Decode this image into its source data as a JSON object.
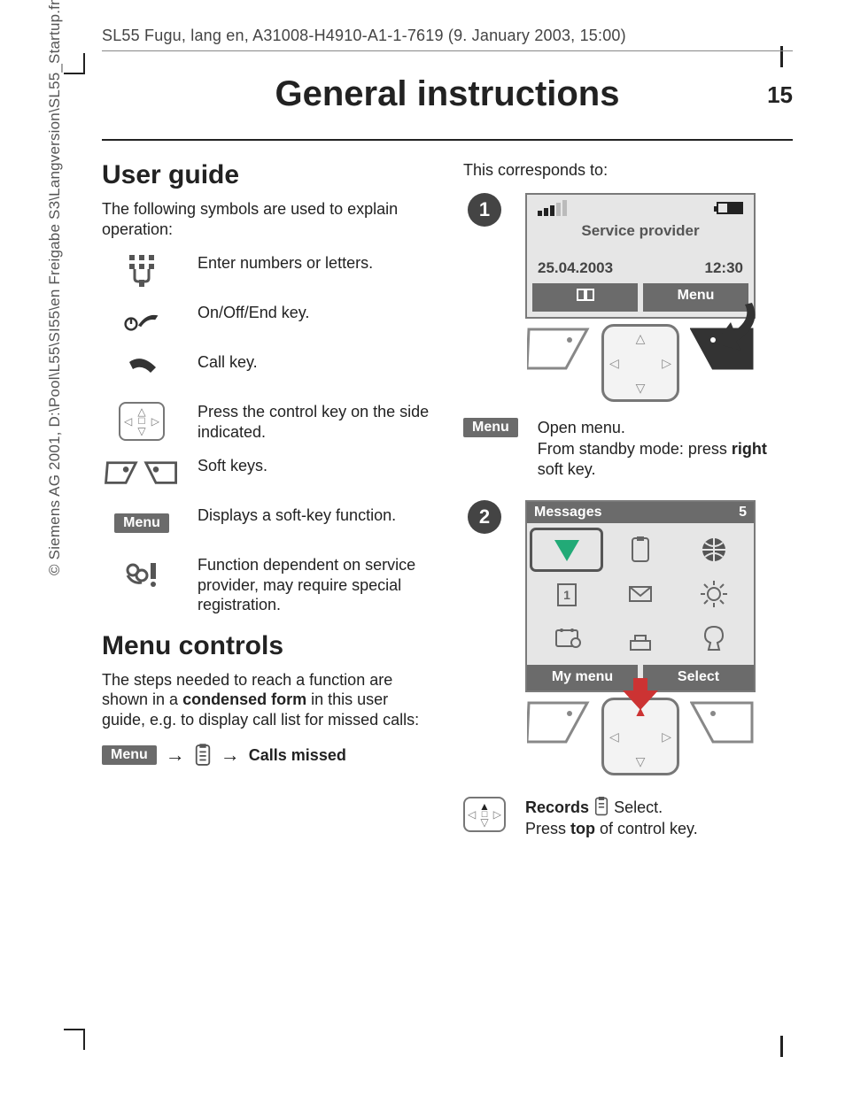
{
  "running_head": "SL55 Fugu, lang en, A31008-H4910-A1-1-7619 (9. January 2003, 15:00)",
  "sideways": "© Siemens AG 2001, D:\\Pool\\L55\\SI55\\en Freigabe S3\\Langversion\\SL55_Startup.fm",
  "title": "General instructions",
  "page_number": "15",
  "left": {
    "h_user_guide": "User guide",
    "intro": "The following symbols are used to explain operation:",
    "rows": [
      "Enter numbers or letters.",
      "On/Off/End key.",
      "Call key.",
      "Press the control key on the side indicated.",
      "Soft keys.",
      "Displays a soft-key function.",
      "Function dependent on service provider, may require special registration."
    ],
    "menu_chip": "Menu",
    "h_menu_controls": "Menu controls",
    "menu_controls_para_a": "The steps needed to reach a function are shown in a ",
    "menu_controls_bold": "condensed form",
    "menu_controls_para_b": " in this user guide, e.g. to display call list for missed calls:",
    "path_target": "Calls missed"
  },
  "right": {
    "corresponds": "This corresponds to:",
    "step1": "1",
    "step2": "2",
    "provider": "Service provider",
    "date": "25.04.2003",
    "time": "12:30",
    "soft_right_1": "Menu",
    "open_menu": "Open menu.",
    "from_standby_a": "From standby mode: press ",
    "from_standby_b": "right",
    "from_standby_c": " soft key.",
    "menu_chip": "Menu",
    "msg_hdr": "Messages",
    "msg_count": "5",
    "soft_left_2": "My menu",
    "soft_right_2": "Select",
    "records_a": "Records",
    "records_b": " Select.",
    "press_top_a": "Press ",
    "press_top_b": "top",
    "press_top_c": " of control key."
  }
}
